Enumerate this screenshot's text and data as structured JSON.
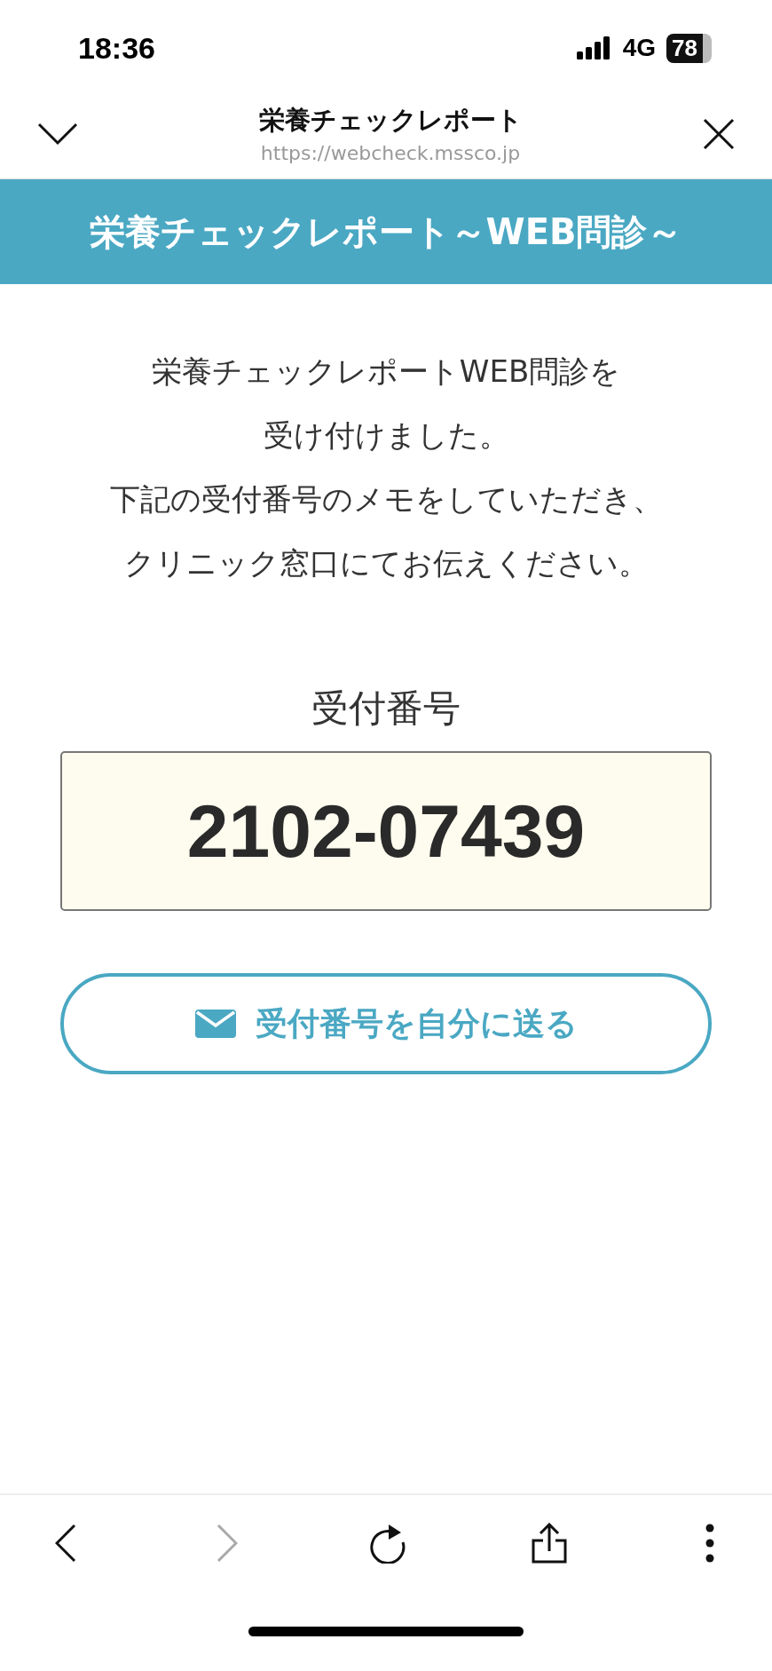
{
  "status_bar": {
    "time": "18:36",
    "network": "4G",
    "battery": "78"
  },
  "browser_header": {
    "title": "栄養チェックレポート",
    "url": "https://webcheck.mssco.jp"
  },
  "banner": {
    "title": "栄養チェックレポート～WEB問診～"
  },
  "message": [
    "栄養チェックレポートWEB問診を",
    "受け付けました。",
    "下記の受付番号のメモをしていただき、",
    "クリニック窓口にてお伝えください。"
  ],
  "receipt": {
    "label": "受付番号",
    "number": "2102-07439"
  },
  "send_button": {
    "label": "受付番号を自分に送る"
  },
  "toolbar": [
    {
      "kind": "back",
      "disabled": false
    },
    {
      "kind": "forward",
      "disabled": true
    },
    {
      "kind": "reload",
      "disabled": false
    },
    {
      "kind": "share",
      "disabled": false
    },
    {
      "kind": "more",
      "disabled": false
    }
  ]
}
